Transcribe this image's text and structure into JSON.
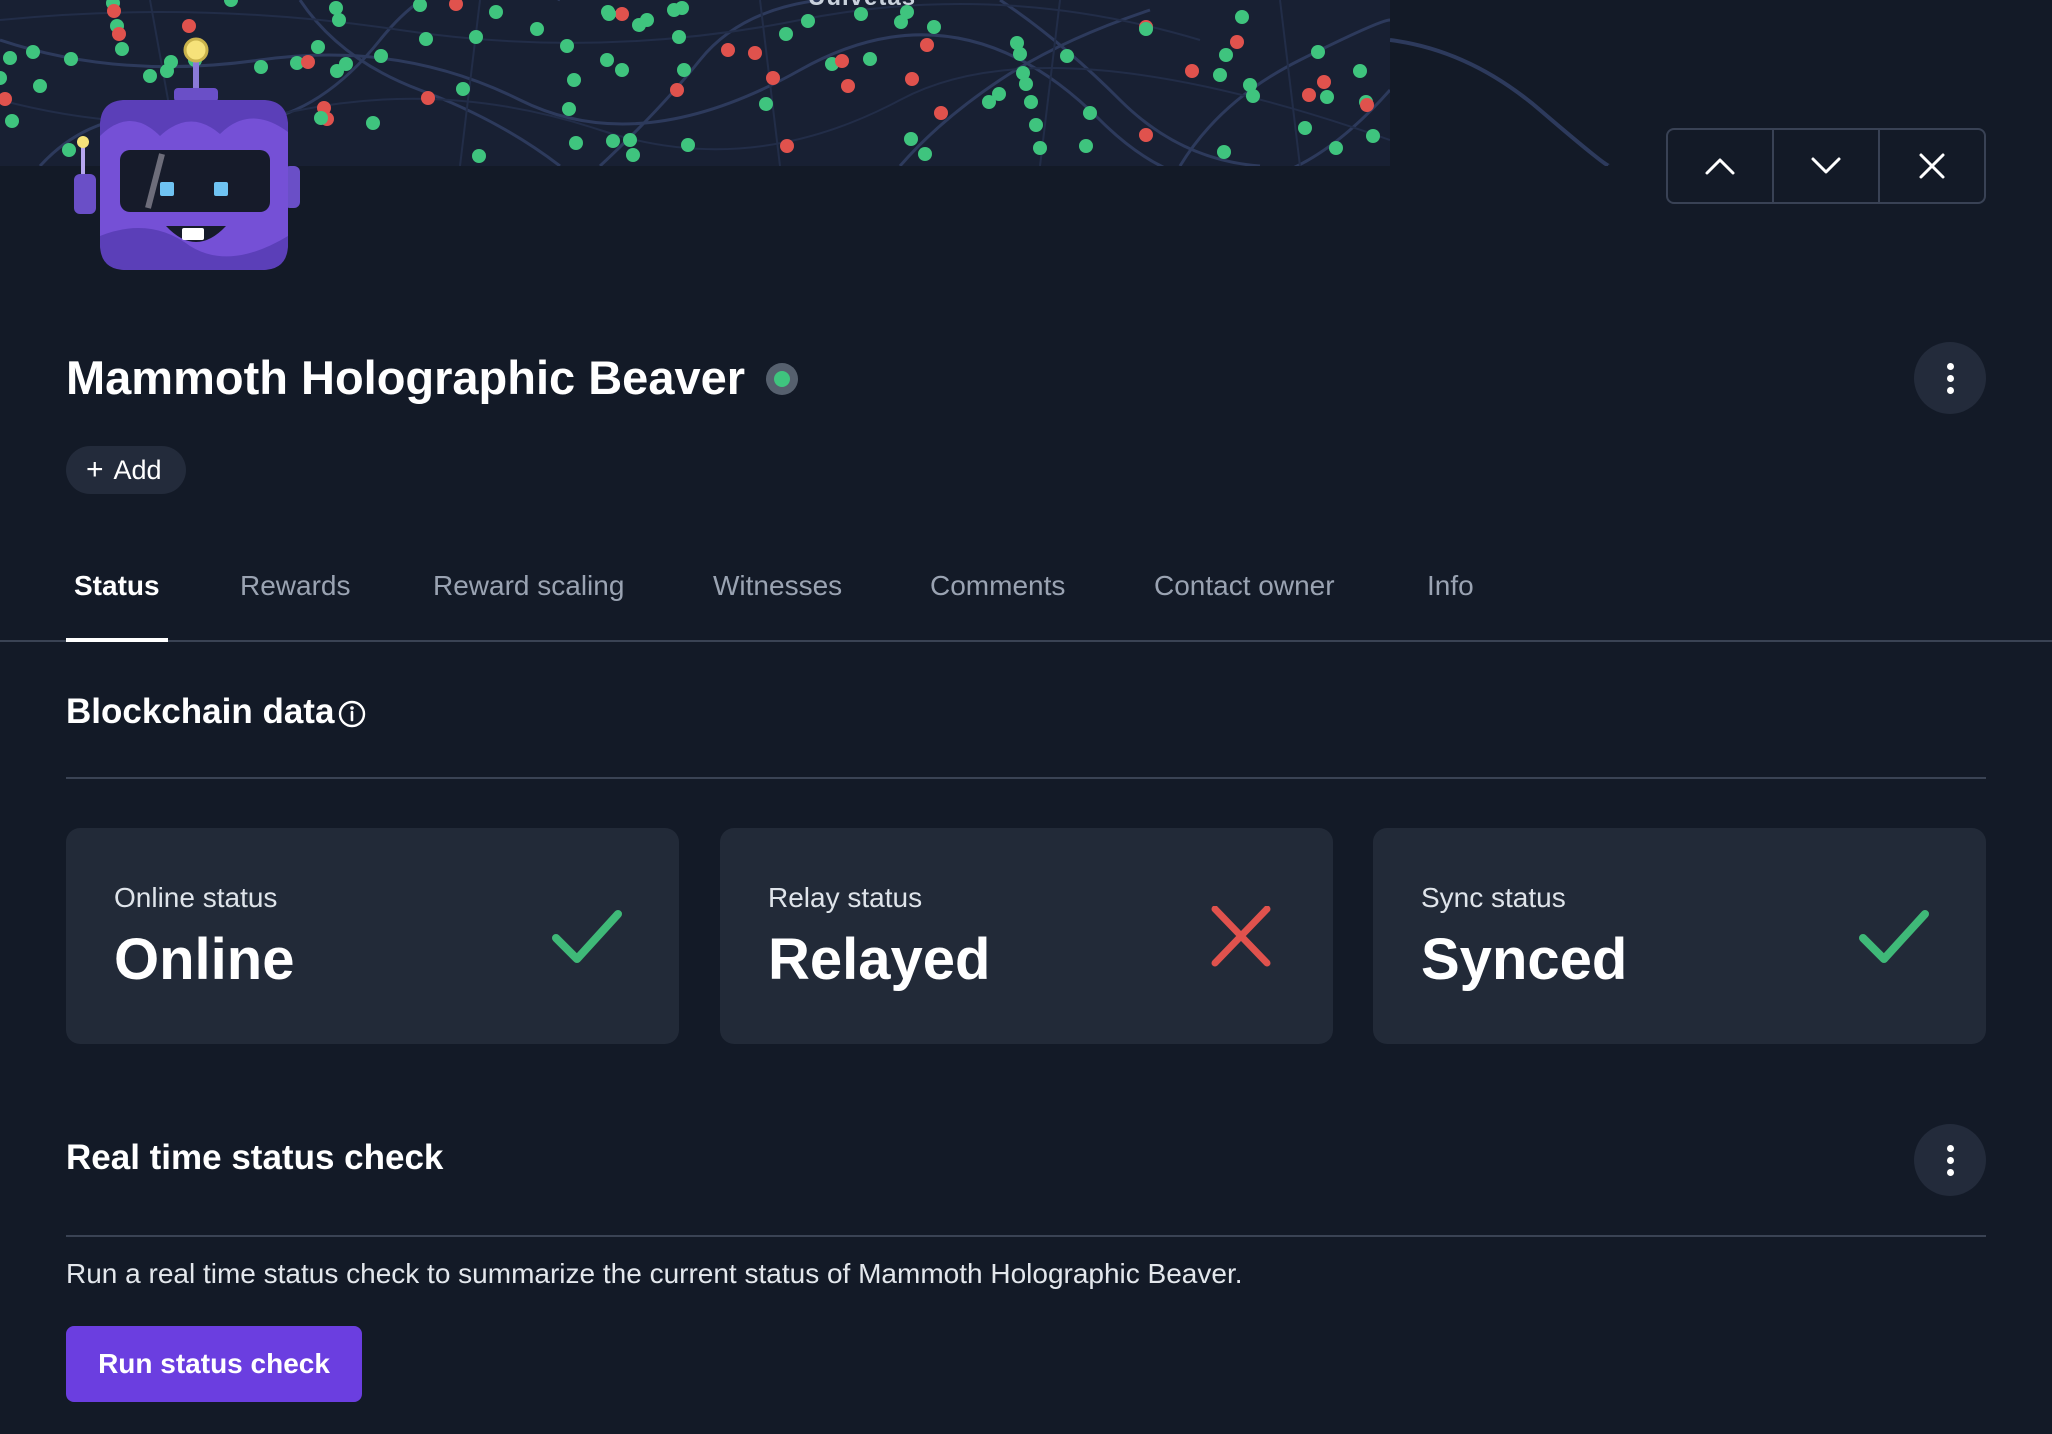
{
  "map": {
    "label": "Uulvetas"
  },
  "header": {
    "title": "Mammoth Holographic Beaver",
    "add_label": "Add",
    "nav": {
      "prev": "chevron-up-icon",
      "next": "chevron-down-icon",
      "close": "close-icon"
    }
  },
  "tabs": [
    {
      "label": "Status",
      "active": true
    },
    {
      "label": "Rewards",
      "active": false
    },
    {
      "label": "Reward scaling",
      "active": false
    },
    {
      "label": "Witnesses",
      "active": false
    },
    {
      "label": "Comments",
      "active": false
    },
    {
      "label": "Contact owner",
      "active": false
    },
    {
      "label": "Info",
      "active": false
    }
  ],
  "blockchain": {
    "title": "Blockchain data",
    "cards": [
      {
        "label": "Online status",
        "value": "Online",
        "icon": "check-icon",
        "color": "#3fb978"
      },
      {
        "label": "Relay status",
        "value": "Relayed",
        "icon": "x-icon",
        "color": "#e0524d"
      },
      {
        "label": "Sync status",
        "value": "Synced",
        "icon": "check-icon",
        "color": "#3fb978"
      }
    ]
  },
  "realtime": {
    "title": "Real time status check",
    "description": "Run a real time status check to summarize the current status of Mammoth Holographic Beaver.",
    "button_label": "Run status check"
  },
  "colors": {
    "background": "#131a27",
    "card": "#222a38",
    "accent": "#6b3ee0",
    "online": "#3fc47e",
    "offline": "#e0524d"
  }
}
